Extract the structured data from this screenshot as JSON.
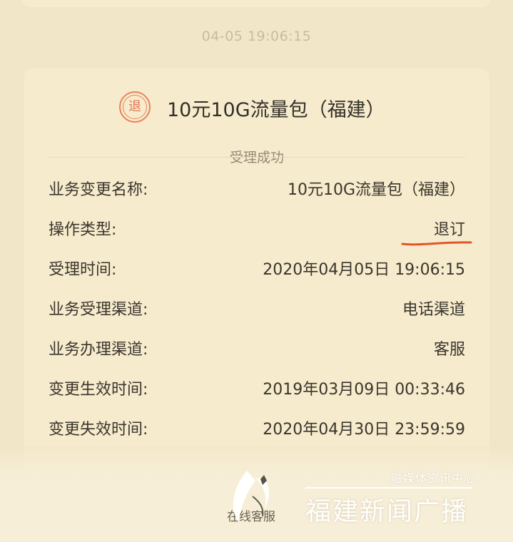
{
  "message": {
    "timestamp": "04-05 19:06:15"
  },
  "card": {
    "badge_char": "退",
    "badge_icon": "unsubscribe-badge-icon",
    "title": "10元10G流量包（福建）",
    "status": "受理成功",
    "rows": [
      {
        "label": "业务变更名称:",
        "value": "10元10G流量包（福建）"
      },
      {
        "label": "操作类型:",
        "value": "退订"
      },
      {
        "label": "受理时间:",
        "value": "2020年04月05日 19:06:15"
      },
      {
        "label": "业务受理渠道:",
        "value": "电话渠道"
      },
      {
        "label": "业务办理渠道:",
        "value": "客服"
      },
      {
        "label": "变更生效时间:",
        "value": "2019年03月09日 00:33:46"
      },
      {
        "label": "变更失效时间:",
        "value": "2020年04月30日 23:59:59"
      }
    ]
  },
  "footer": {
    "partial_text": "在线客服"
  },
  "watermark": {
    "small": "融媒体资讯中心",
    "big": "福建新闻广播",
    "logo_icon": "brush-stroke-logo-icon"
  },
  "colors": {
    "background": "#f2e6c8",
    "card": "#f7ebcd",
    "accent": "#e8825a",
    "underline": "#e0552a"
  }
}
